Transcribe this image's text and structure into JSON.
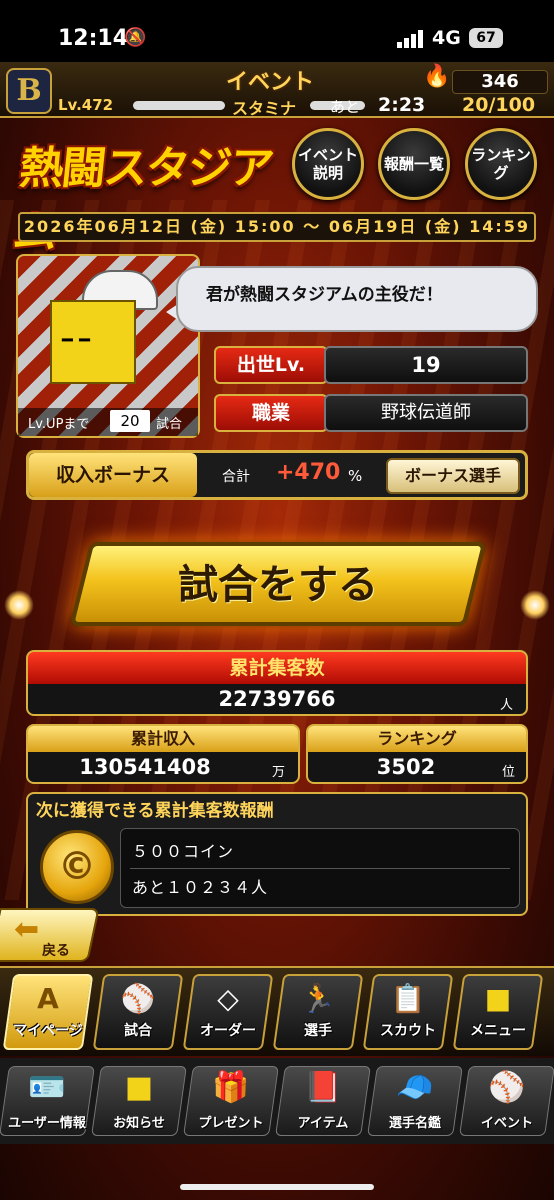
{
  "status": {
    "time": "12:14",
    "network": "4G",
    "battery": "67"
  },
  "header": {
    "logo": "B",
    "title": "イベント",
    "coins": "346",
    "level": "Lv.472",
    "stamina_label": "スタミナ",
    "remain_label": "あと",
    "remain_time": "2:23",
    "stamina": "20/100"
  },
  "event": {
    "logo_text": "熱闘スタジアム",
    "buttons": {
      "desc": "イベント説明",
      "rewards": "報酬一覧",
      "ranking": "ランキング"
    },
    "period": "2026年06月12日 (金) 15:00 ～ 06月19日 (金) 14:59"
  },
  "profile": {
    "speech": "君が熱闘スタジアムの主役だ！",
    "lvup_label": "Lv.UPまで",
    "lvup_value": "20",
    "lvup_suffix": "試合",
    "rank_label": "出世Lv.",
    "rank_value": "19",
    "job_label": "職業",
    "job_value": "野球伝道師"
  },
  "bonus": {
    "label": "収入ボーナス",
    "sum_label": "合計",
    "value": "+470",
    "pct": "%",
    "button": "ボーナス選手"
  },
  "play_button": "試合をする",
  "stats": {
    "total_label": "累計集客数",
    "total_value": "22739766",
    "total_unit": "人",
    "income_label": "累計収入",
    "income_value": "130541408",
    "income_unit": "万",
    "ranking_label": "ランキング",
    "ranking_value": "3502",
    "ranking_unit": "位"
  },
  "next_reward": {
    "title": "次に獲得できる累計集客数報酬",
    "coin_symbol": "©",
    "item": "５００コイン",
    "remaining": "あと１０２３４人"
  },
  "back": "戻る",
  "nav_main": [
    "マイページ",
    "試合",
    "オーダー",
    "選手",
    "スカウト",
    "メニュー"
  ],
  "nav_sub": [
    "ユーザー情報",
    "お知らせ",
    "プレゼント",
    "アイテム",
    "選手名鑑",
    "イベント"
  ],
  "colors": {
    "accent": "#d8b13e",
    "red": "#c4180a",
    "gold": "#ffd45a"
  }
}
